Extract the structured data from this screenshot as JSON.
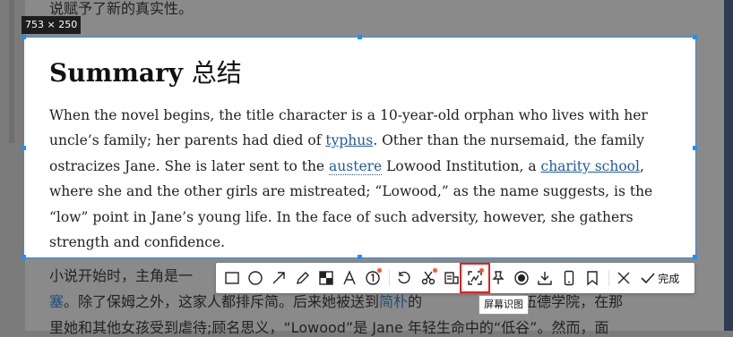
{
  "size_label": "753 × 250",
  "selection": {
    "title_en": "Summary",
    "title_cn": "总结",
    "body": {
      "l1": "When the novel begins, the title character is a 10-year-old orphan who lives with her",
      "l2a": "uncle’s family; her parents had died of ",
      "l2_link": "typhus",
      "l2b": ". Other than the nursemaid, the family",
      "l3a": "ostracizes Jane. She is later sent to the ",
      "l3_link1": "austere",
      "l3b": " Lowood Institution, a ",
      "l3_link2": "charity school",
      "l3c": ",",
      "l4": "where she and the other girls are mistreated; “Lowood,” as the name suggests, is the",
      "l5": "“low” point in Jane’s young life. In the face of such adversity, however, she gathers",
      "l6": "strength and confidence."
    }
  },
  "background": {
    "top_line": "说赋予了新的真实性。",
    "line1": "小说开始时，主角是一",
    "line2a": "塞",
    "line2b": "。除了保姆之外，这家人都排斥简。后来她被送到",
    "line2_link": "简朴",
    "line2c": "的",
    "line2d": "罗伍德学院，在那",
    "line3": "里她和其他女孩受到虐待;顾名思义，“Lowood”是 Jane 年轻生命中的“低谷”。然而，面"
  },
  "toolbar": {
    "tools": [
      "rectangle-icon",
      "ellipse-icon",
      "arrow-icon",
      "pencil-icon",
      "mosaic-icon",
      "text-icon",
      "number-icon",
      "undo-icon",
      "scissors-icon",
      "ocr-icon",
      "screen-recognize-icon",
      "pin-icon",
      "record-icon",
      "download-icon",
      "phone-icon",
      "bookmark-icon",
      "close-icon"
    ],
    "done_label": "完成"
  },
  "tooltip": "屏幕识图"
}
